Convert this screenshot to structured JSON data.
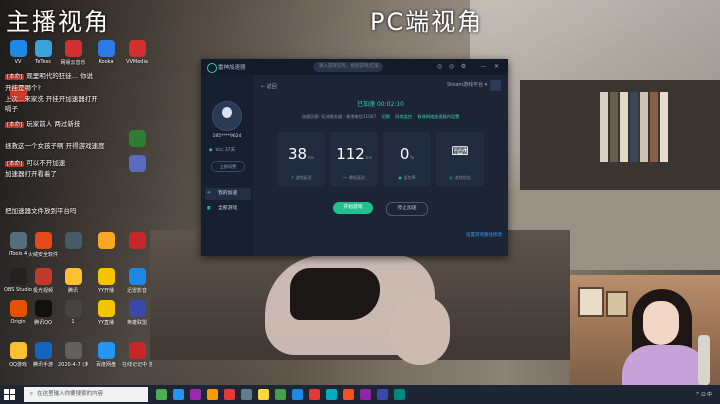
{
  "overlay": {
    "left_caption": "主播视角",
    "right_caption": "PC端视角"
  },
  "desktop_icons": [
    {
      "label": "VV",
      "color": "#1e88e5"
    },
    {
      "label": "TeTess",
      "color": "#37a3d8"
    },
    {
      "label": "网易云音乐",
      "color": "#d0302f"
    },
    {
      "label": "Kooka",
      "color": "#2c7be5"
    },
    {
      "label": "VVMedia",
      "color": "#d32f2f"
    },
    {
      "label": "",
      "color": "#d33c2b"
    },
    {
      "label": "",
      "color": "#2e7d32"
    },
    {
      "label": "",
      "color": "#5c6bc0"
    },
    {
      "label": "iTools 4",
      "color": "#546e7a"
    },
    {
      "label": "火绒安全软件",
      "color": "#e64a19"
    },
    {
      "label": "",
      "color": "#455a64"
    },
    {
      "label": "",
      "color": "#f9a825"
    },
    {
      "label": "",
      "color": "#c62828"
    },
    {
      "label": "OBS Studio",
      "color": "#222222"
    },
    {
      "label": "极光视频",
      "color": "#c0392b"
    },
    {
      "label": "腾讯",
      "color": "#fbc02d"
    },
    {
      "label": "YY开播",
      "color": "#f5c400"
    },
    {
      "label": "迅雷影音",
      "color": "#1e88e5"
    },
    {
      "label": "Origin",
      "color": "#e65100"
    },
    {
      "label": "腾讯QQ",
      "color": "#111111"
    },
    {
      "label": "1",
      "color": "#444444"
    },
    {
      "label": "YY直播",
      "color": "#f5c400"
    },
    {
      "label": "英雄联盟",
      "color": "#3949ab"
    },
    {
      "label": "QQ游戏",
      "color": "#fbc02d"
    },
    {
      "label": "腾讯手游",
      "color": "#1565c0"
    },
    {
      "label": "2020-4-7 (未命名)",
      "color": "#616161"
    },
    {
      "label": "百度网盘",
      "color": "#2196f3"
    },
    {
      "label": "在线记记中 游戏玩家MA...",
      "color": "#c62828"
    }
  ],
  "chat": [
    {
      "tag": "[本命]",
      "text": "观里明代的狂徒... 你说"
    },
    {
      "tag": "",
      "text": "开挂是哪个?"
    },
    {
      "tag": "",
      "text": "上次...来家洗  开挂开加速器打开"
    },
    {
      "tag": "",
      "text": "嗝子"
    },
    {
      "tag": "[本命]",
      "text": "玩家前人 两过新技"
    },
    {
      "tag": "",
      "text": "拯救这一个女孩子啊 开得游戏速度"
    },
    {
      "tag": "[本命]",
      "text": "可以不开加速"
    },
    {
      "tag": "",
      "text": "加速器打开看着了"
    },
    {
      "tag": "",
      "text": "把加速器文件放到平台吗"
    }
  ],
  "app": {
    "title": "雷神加速器",
    "search_placeholder": "输入游戏名称，搜索游戏/区服",
    "controls": [
      "◎",
      "◎",
      "⚙",
      "—",
      "✕"
    ],
    "user": {
      "name": "185****9624",
      "vip": "Vcc 37天",
      "renew_label": "立即续费"
    },
    "nav": [
      {
        "icon": "✈",
        "label": "我的加速",
        "active": true
      },
      {
        "icon": "◧",
        "label": "全部游戏",
        "active": false
      }
    ],
    "back_label": "← 返回",
    "game_selector": "Steam游戏平台 ▾",
    "timer": "已加速 00:02:10",
    "info": {
      "server": "加速区服: 亚洲服务器 · 香港电信11007",
      "links": [
        "切换",
        "网络监控",
        "修改网络加速器内设置"
      ]
    },
    "stats": [
      {
        "value": "38",
        "unit": "ms",
        "label": "游戏延迟",
        "icon": "↗"
      },
      {
        "value": "112",
        "unit": "ms",
        "label": "降低延迟",
        "icon": "〜"
      },
      {
        "value": "0",
        "unit": "%",
        "label": "丢包率",
        "icon": "◉"
      },
      {
        "value": "",
        "unit": "",
        "label": "游戏优化",
        "icon": "◎"
      }
    ],
    "start_button": "开始游戏",
    "stop_button": "停止加速",
    "footer_link": "设置游戏路径修改"
  },
  "taskbar": {
    "search_placeholder": "在这里输入你要搜索的内容",
    "icons": [
      "#4caf50",
      "#2196f3",
      "#9c27b0",
      "#ff9800",
      "#e53935",
      "#607d8b",
      "#fdd835",
      "#43a047",
      "#1e88e5",
      "#e53935",
      "#00acc1",
      "#f4511e",
      "#8e24aa",
      "#3949ab",
      "#00897b"
    ],
    "tray": "^ ⊡ 中"
  }
}
